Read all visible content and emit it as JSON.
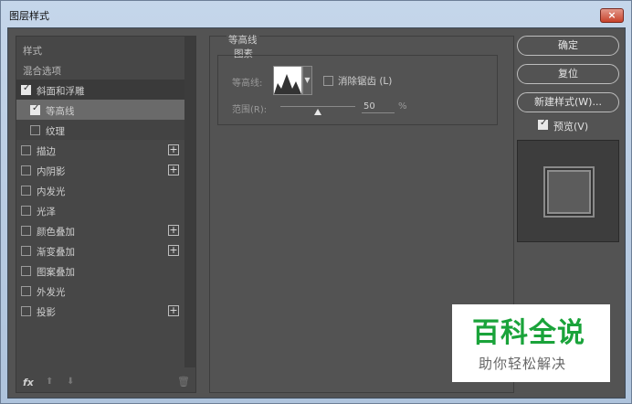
{
  "window": {
    "title": "图层样式",
    "close_label": "×"
  },
  "styles_list": {
    "header_styles": "样式",
    "header_blending": "混合选项",
    "items": [
      {
        "label": "斜面和浮雕",
        "checked": true,
        "add": false
      },
      {
        "label": "等高线",
        "checked": true,
        "add": false
      },
      {
        "label": "纹理",
        "checked": false,
        "add": false
      },
      {
        "label": "描边",
        "checked": false,
        "add": true
      },
      {
        "label": "内阴影",
        "checked": false,
        "add": true
      },
      {
        "label": "内发光",
        "checked": false,
        "add": false
      },
      {
        "label": "光泽",
        "checked": false,
        "add": false
      },
      {
        "label": "颜色叠加",
        "checked": false,
        "add": true
      },
      {
        "label": "渐变叠加",
        "checked": false,
        "add": true
      },
      {
        "label": "图案叠加",
        "checked": false,
        "add": false
      },
      {
        "label": "外发光",
        "checked": false,
        "add": false
      },
      {
        "label": "投影",
        "checked": false,
        "add": true
      }
    ],
    "fx_label": "fx",
    "up_arrow": "⬆",
    "down_arrow": "⬇",
    "trash_icon": "🗑"
  },
  "contour_panel": {
    "group_title": "等高线",
    "sub_title": "图素",
    "contour_label": "等高线:",
    "anti_alias_label": "消除锯齿 (L)",
    "anti_alias_checked": false,
    "range_label": "范围(R):",
    "range_value": "50",
    "range_fraction": 0.5,
    "range_unit": "%"
  },
  "buttons": {
    "ok": "确定",
    "reset": "复位",
    "new_style": "新建样式(W)...",
    "preview_label": "预览(V)",
    "preview_checked": true
  },
  "watermark": {
    "title": "百科全说",
    "subtitle": "助你轻松解决"
  },
  "colors": {
    "panel_bg": "#535353",
    "list_bg": "#474747",
    "accent": "#1aa33a"
  }
}
